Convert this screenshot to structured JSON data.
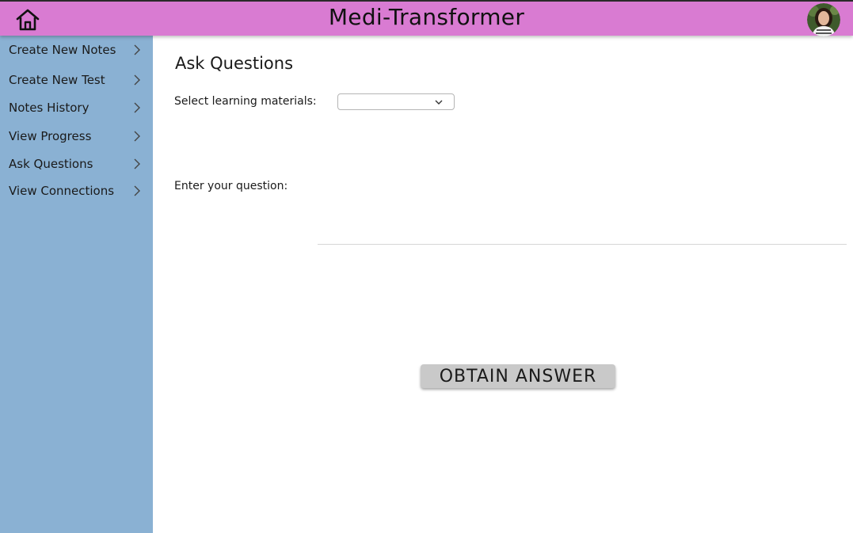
{
  "header": {
    "title": "Medi-Transformer",
    "home_icon": "home-icon",
    "avatar_icon": "user-avatar",
    "background_color": "#d97bd2"
  },
  "sidebar": {
    "background_color": "#8ab1d3",
    "items": [
      {
        "label": "Create New Notes",
        "icon": "chevron-right-icon"
      },
      {
        "label": "Create New Test",
        "icon": "chevron-right-icon"
      },
      {
        "label": "Notes History",
        "icon": "chevron-right-icon"
      },
      {
        "label": "View Progress",
        "icon": "chevron-right-icon"
      },
      {
        "label": "Ask Questions",
        "icon": "chevron-right-icon"
      },
      {
        "label": "View Connections",
        "icon": "chevron-right-icon"
      }
    ]
  },
  "main": {
    "title": "Ask Questions",
    "materials_label": "Select learning materials:",
    "materials_selected": "",
    "question_label": "Enter your question:",
    "question_value": "",
    "submit_label": "OBTAIN ANSWER"
  }
}
